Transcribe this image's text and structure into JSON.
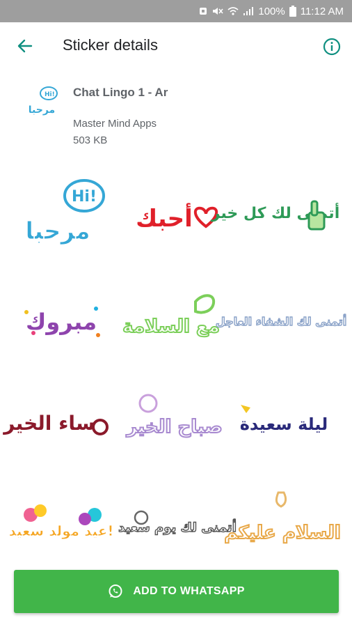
{
  "status_bar": {
    "battery": "100%",
    "time": "11:12 AM"
  },
  "app_bar": {
    "title": "Sticker details"
  },
  "pack": {
    "name": "Chat Lingo 1 - Ar",
    "publisher": "Master Mind Apps",
    "size": "503 KB",
    "icon_text": "مرحبا"
  },
  "stickers": [
    {
      "text": "مرحبا",
      "badge": "Hi!"
    },
    {
      "text": "أحبك"
    },
    {
      "text": "أتمنى لك كل خير"
    },
    {
      "text": "مبروك"
    },
    {
      "text": "مع السلامة"
    },
    {
      "text": "أتمنى لك الشفاء العاجل"
    },
    {
      "text": "مساء الخير"
    },
    {
      "text": "صباح الخير"
    },
    {
      "text": "ليلة سعيدة"
    },
    {
      "text": "عيد مولد سعيد!"
    },
    {
      "text": "أتمنى لك يوم سعيد"
    },
    {
      "text": "السلام عليكم"
    }
  ],
  "add_button": {
    "label": "ADD TO WHATSAPP"
  },
  "colors": {
    "accent": "#0f8f80",
    "button": "#41b549"
  }
}
